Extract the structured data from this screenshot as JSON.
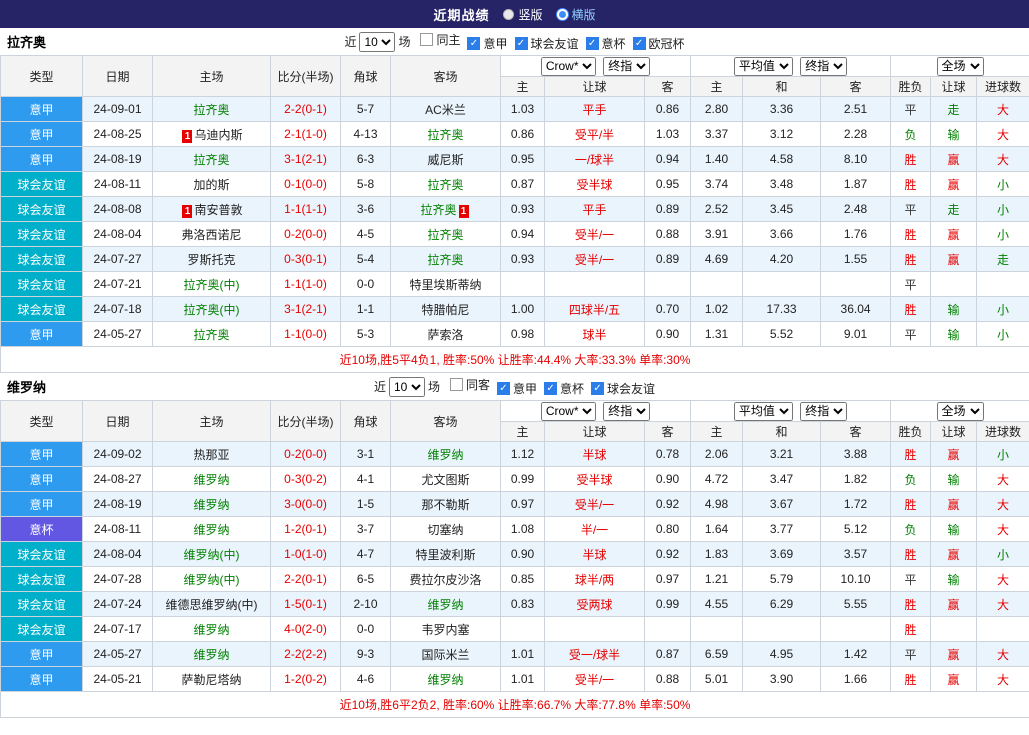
{
  "topbar": {
    "title": "近期战绩",
    "vertical_label": "竖版",
    "horizontal_label": "横版"
  },
  "labels": {
    "near": "近",
    "unit": "场"
  },
  "table_header": {
    "cols": [
      "类型",
      "日期",
      "主场",
      "比分(半场)",
      "角球",
      "客场"
    ],
    "g1_select_a": "Crow*",
    "g1_select_b": "终指",
    "g1_cols": [
      "主",
      "让球",
      "客"
    ],
    "g2_select_a": "平均值",
    "g2_select_b": "终指",
    "g2_cols": [
      "主",
      "和",
      "客"
    ],
    "g3_select": "全场",
    "g3_cols": [
      "胜负",
      "让球",
      "进球数"
    ]
  },
  "sections": [
    {
      "team": "拉齐奥",
      "filter": {
        "count": "10",
        "checkboxes": [
          {
            "label": "同主",
            "checked": false
          },
          {
            "label": "意甲",
            "checked": true
          },
          {
            "label": "球会友谊",
            "checked": true
          },
          {
            "label": "意杯",
            "checked": true
          },
          {
            "label": "欧冠杯",
            "checked": true
          }
        ]
      },
      "rows": [
        {
          "type": "意甲",
          "tk": "sa",
          "date": "24-09-01",
          "home": {
            "n": "拉齐奥",
            "self": true
          },
          "score": "2-2(0-1)",
          "corner": "5-7",
          "away": {
            "n": "AC米兰"
          },
          "o": [
            "1.03",
            "平手",
            "0.86"
          ],
          "a": [
            "2.80",
            "3.36",
            "2.51"
          ],
          "r": [
            [
              "平",
              "d"
            ],
            [
              "走",
              "g"
            ],
            [
              "大",
              "r"
            ]
          ]
        },
        {
          "type": "意甲",
          "tk": "sa",
          "date": "24-08-25",
          "home": {
            "n": "乌迪内斯",
            "rc": "1"
          },
          "score": "2-1(1-0)",
          "corner": "4-13",
          "away": {
            "n": "拉齐奥",
            "self": true
          },
          "o": [
            "0.86",
            "受平/半",
            "1.03"
          ],
          "a": [
            "3.37",
            "3.12",
            "2.28"
          ],
          "r": [
            [
              "负",
              "g"
            ],
            [
              "输",
              "g"
            ],
            [
              "大",
              "r"
            ]
          ]
        },
        {
          "type": "意甲",
          "tk": "sa",
          "date": "24-08-19",
          "home": {
            "n": "拉齐奥",
            "self": true
          },
          "score": "3-1(2-1)",
          "corner": "6-3",
          "away": {
            "n": "威尼斯"
          },
          "o": [
            "0.95",
            "一/球半",
            "0.94"
          ],
          "a": [
            "1.40",
            "4.58",
            "8.10"
          ],
          "r": [
            [
              "胜",
              "r"
            ],
            [
              "赢",
              "r"
            ],
            [
              "大",
              "r"
            ]
          ]
        },
        {
          "type": "球会友谊",
          "tk": "fr",
          "date": "24-08-11",
          "home": {
            "n": "加的斯"
          },
          "score": "0-1(0-0)",
          "corner": "5-8",
          "away": {
            "n": "拉齐奥",
            "self": true
          },
          "o": [
            "0.87",
            "受半球",
            "0.95"
          ],
          "a": [
            "3.74",
            "3.48",
            "1.87"
          ],
          "r": [
            [
              "胜",
              "r"
            ],
            [
              "赢",
              "r"
            ],
            [
              "小",
              "g"
            ]
          ]
        },
        {
          "type": "球会友谊",
          "tk": "fr",
          "date": "24-08-08",
          "home": {
            "n": "南安普敦",
            "rc": "1"
          },
          "score": "1-1(1-1)",
          "corner": "3-6",
          "away": {
            "n": "拉齐奥",
            "self": true,
            "rc2": "1"
          },
          "o": [
            "0.93",
            "平手",
            "0.89"
          ],
          "a": [
            "2.52",
            "3.45",
            "2.48"
          ],
          "r": [
            [
              "平",
              "d"
            ],
            [
              "走",
              "g"
            ],
            [
              "小",
              "g"
            ]
          ]
        },
        {
          "type": "球会友谊",
          "tk": "fr",
          "date": "24-08-04",
          "home": {
            "n": "弗洛西诺尼"
          },
          "score": "0-2(0-0)",
          "corner": "4-5",
          "away": {
            "n": "拉齐奥",
            "self": true
          },
          "o": [
            "0.94",
            "受半/一",
            "0.88"
          ],
          "a": [
            "3.91",
            "3.66",
            "1.76"
          ],
          "r": [
            [
              "胜",
              "r"
            ],
            [
              "赢",
              "r"
            ],
            [
              "小",
              "g"
            ]
          ]
        },
        {
          "type": "球会友谊",
          "tk": "fr",
          "date": "24-07-27",
          "home": {
            "n": "罗斯托克"
          },
          "score": "0-3(0-1)",
          "corner": "5-4",
          "away": {
            "n": "拉齐奥",
            "self": true
          },
          "o": [
            "0.93",
            "受半/一",
            "0.89"
          ],
          "a": [
            "4.69",
            "4.20",
            "1.55"
          ],
          "r": [
            [
              "胜",
              "r"
            ],
            [
              "赢",
              "r"
            ],
            [
              "走",
              "g"
            ]
          ]
        },
        {
          "type": "球会友谊",
          "tk": "fr",
          "date": "24-07-21",
          "home": {
            "n": "拉齐奥(中)",
            "self": true
          },
          "score": "1-1(1-0)",
          "corner": "0-0",
          "away": {
            "n": "特里埃斯蒂纳"
          },
          "o": [
            "",
            "",
            ""
          ],
          "a": [
            "",
            "",
            ""
          ],
          "r": [
            [
              "平",
              "d"
            ],
            [
              "",
              "d"
            ],
            [
              "",
              "d"
            ]
          ]
        },
        {
          "type": "球会友谊",
          "tk": "fr",
          "date": "24-07-18",
          "home": {
            "n": "拉齐奥(中)",
            "self": true
          },
          "score": "3-1(2-1)",
          "corner": "1-1",
          "away": {
            "n": "特腊帕尼"
          },
          "o": [
            "1.00",
            "四球半/五",
            "0.70"
          ],
          "a": [
            "1.02",
            "17.33",
            "36.04"
          ],
          "r": [
            [
              "胜",
              "r"
            ],
            [
              "输",
              "g"
            ],
            [
              "小",
              "g"
            ]
          ]
        },
        {
          "type": "意甲",
          "tk": "sa",
          "date": "24-05-27",
          "home": {
            "n": "拉齐奥",
            "self": true
          },
          "score": "1-1(0-0)",
          "corner": "5-3",
          "away": {
            "n": "萨索洛"
          },
          "o": [
            "0.98",
            "球半",
            "0.90"
          ],
          "a": [
            "1.31",
            "5.52",
            "9.01"
          ],
          "r": [
            [
              "平",
              "d"
            ],
            [
              "输",
              "g"
            ],
            [
              "小",
              "g"
            ]
          ]
        }
      ],
      "summary": "近10场,胜5平4负1, 胜率:50% 让胜率:44.4% 大率:33.3% 单率:30%"
    },
    {
      "team": "维罗纳",
      "filter": {
        "count": "10",
        "checkboxes": [
          {
            "label": "同客",
            "checked": false
          },
          {
            "label": "意甲",
            "checked": true
          },
          {
            "label": "意杯",
            "checked": true
          },
          {
            "label": "球会友谊",
            "checked": true
          }
        ]
      },
      "rows": [
        {
          "type": "意甲",
          "tk": "sa",
          "date": "24-09-02",
          "home": {
            "n": "热那亚"
          },
          "score": "0-2(0-0)",
          "corner": "3-1",
          "away": {
            "n": "维罗纳",
            "self": true
          },
          "o": [
            "1.12",
            "半球",
            "0.78"
          ],
          "a": [
            "2.06",
            "3.21",
            "3.88"
          ],
          "r": [
            [
              "胜",
              "r"
            ],
            [
              "赢",
              "r"
            ],
            [
              "小",
              "g"
            ]
          ]
        },
        {
          "type": "意甲",
          "tk": "sa",
          "date": "24-08-27",
          "home": {
            "n": "维罗纳",
            "self": true
          },
          "score": "0-3(0-2)",
          "corner": "4-1",
          "away": {
            "n": "尤文图斯"
          },
          "o": [
            "0.99",
            "受半球",
            "0.90"
          ],
          "a": [
            "4.72",
            "3.47",
            "1.82"
          ],
          "r": [
            [
              "负",
              "g"
            ],
            [
              "输",
              "g"
            ],
            [
              "大",
              "r"
            ]
          ]
        },
        {
          "type": "意甲",
          "tk": "sa",
          "date": "24-08-19",
          "home": {
            "n": "维罗纳",
            "self": true
          },
          "score": "3-0(0-0)",
          "corner": "1-5",
          "away": {
            "n": "那不勒斯"
          },
          "o": [
            "0.97",
            "受半/一",
            "0.92"
          ],
          "a": [
            "4.98",
            "3.67",
            "1.72"
          ],
          "r": [
            [
              "胜",
              "r"
            ],
            [
              "赢",
              "r"
            ],
            [
              "大",
              "r"
            ]
          ]
        },
        {
          "type": "意杯",
          "tk": "cup",
          "date": "24-08-11",
          "home": {
            "n": "维罗纳",
            "self": true
          },
          "score": "1-2(0-1)",
          "corner": "3-7",
          "away": {
            "n": "切塞纳"
          },
          "o": [
            "1.08",
            "半/一",
            "0.80"
          ],
          "a": [
            "1.64",
            "3.77",
            "5.12"
          ],
          "r": [
            [
              "负",
              "g"
            ],
            [
              "输",
              "g"
            ],
            [
              "大",
              "r"
            ]
          ]
        },
        {
          "type": "球会友谊",
          "tk": "fr",
          "date": "24-08-04",
          "home": {
            "n": "维罗纳(中)",
            "self": true
          },
          "score": "1-0(1-0)",
          "corner": "4-7",
          "away": {
            "n": "特里波利斯"
          },
          "o": [
            "0.90",
            "半球",
            "0.92"
          ],
          "a": [
            "1.83",
            "3.69",
            "3.57"
          ],
          "r": [
            [
              "胜",
              "r"
            ],
            [
              "赢",
              "r"
            ],
            [
              "小",
              "g"
            ]
          ]
        },
        {
          "type": "球会友谊",
          "tk": "fr",
          "date": "24-07-28",
          "home": {
            "n": "维罗纳(中)",
            "self": true
          },
          "score": "2-2(0-1)",
          "corner": "6-5",
          "away": {
            "n": "费拉尔皮沙洛"
          },
          "o": [
            "0.85",
            "球半/两",
            "0.97"
          ],
          "a": [
            "1.21",
            "5.79",
            "10.10"
          ],
          "r": [
            [
              "平",
              "d"
            ],
            [
              "输",
              "g"
            ],
            [
              "大",
              "r"
            ]
          ]
        },
        {
          "type": "球会友谊",
          "tk": "fr",
          "date": "24-07-24",
          "home": {
            "n": "维德思维罗纳(中)"
          },
          "score": "1-5(0-1)",
          "corner": "2-10",
          "away": {
            "n": "维罗纳",
            "self": true
          },
          "o": [
            "0.83",
            "受两球",
            "0.99"
          ],
          "a": [
            "4.55",
            "6.29",
            "5.55"
          ],
          "r": [
            [
              "胜",
              "r"
            ],
            [
              "赢",
              "r"
            ],
            [
              "大",
              "r"
            ]
          ]
        },
        {
          "type": "球会友谊",
          "tk": "fr",
          "date": "24-07-17",
          "home": {
            "n": "维罗纳",
            "self": true
          },
          "score": "4-0(2-0)",
          "corner": "0-0",
          "away": {
            "n": "韦罗内塞"
          },
          "o": [
            "",
            "",
            ""
          ],
          "a": [
            "",
            "",
            ""
          ],
          "r": [
            [
              "胜",
              "r"
            ],
            [
              "",
              "d"
            ],
            [
              "",
              "d"
            ]
          ]
        },
        {
          "type": "意甲",
          "tk": "sa",
          "date": "24-05-27",
          "home": {
            "n": "维罗纳",
            "self": true
          },
          "score": "2-2(2-2)",
          "corner": "9-3",
          "away": {
            "n": "国际米兰"
          },
          "o": [
            "1.01",
            "受一/球半",
            "0.87"
          ],
          "a": [
            "6.59",
            "4.95",
            "1.42"
          ],
          "r": [
            [
              "平",
              "d"
            ],
            [
              "赢",
              "r"
            ],
            [
              "大",
              "r"
            ]
          ]
        },
        {
          "type": "意甲",
          "tk": "sa",
          "date": "24-05-21",
          "home": {
            "n": "萨勒尼塔纳"
          },
          "score": "1-2(0-2)",
          "corner": "4-6",
          "away": {
            "n": "维罗纳",
            "self": true
          },
          "o": [
            "1.01",
            "受半/一",
            "0.88"
          ],
          "a": [
            "5.01",
            "3.90",
            "1.66"
          ],
          "r": [
            [
              "胜",
              "r"
            ],
            [
              "赢",
              "r"
            ],
            [
              "大",
              "r"
            ]
          ]
        }
      ],
      "summary": "近10场,胜6平2负2, 胜率:60% 让胜率:66.7% 大率:77.8% 单率:50%"
    }
  ]
}
